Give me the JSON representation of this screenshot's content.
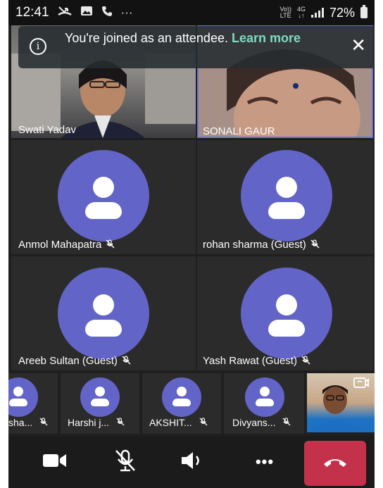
{
  "status_bar": {
    "time": "12:41",
    "icons": [
      "missed-call-icon",
      "gallery-icon",
      "phone-icon",
      "more-dots-icon"
    ],
    "more": "···",
    "volte_top": "Vo))",
    "volte_bottom": "LTE",
    "network_top": "4G",
    "network_bottom": "↓↑",
    "battery": "72%"
  },
  "banner": {
    "message": "You're joined as an attendee. ",
    "link": "Learn more",
    "info_glyph": "i",
    "close_glyph": "✕"
  },
  "top_videos": [
    {
      "name": "Swati Yadav"
    },
    {
      "name": "SONALI GAUR"
    }
  ],
  "participants": [
    {
      "name": "Anmol Mahapatra",
      "muted": true
    },
    {
      "name": "rohan sharma (Guest)",
      "muted": true
    },
    {
      "name": "Areeb Sultan (Guest)",
      "muted": true
    },
    {
      "name": "Yash Rawat (Guest)",
      "muted": true
    }
  ],
  "strip": [
    {
      "name": "sha..."
    },
    {
      "name": "Harshi j..."
    },
    {
      "name": "AKSHIT..."
    },
    {
      "name": "Divyans..."
    }
  ],
  "controls": [
    "camera-icon",
    "mic-off-icon",
    "speaker-icon",
    "more-icon",
    "hang-up-icon"
  ],
  "more_glyph": "•••",
  "colors": {
    "avatar": "#6264c7",
    "hangup": "#c4314b",
    "link": "#7fd9c4",
    "background": "#1f1f1f"
  }
}
